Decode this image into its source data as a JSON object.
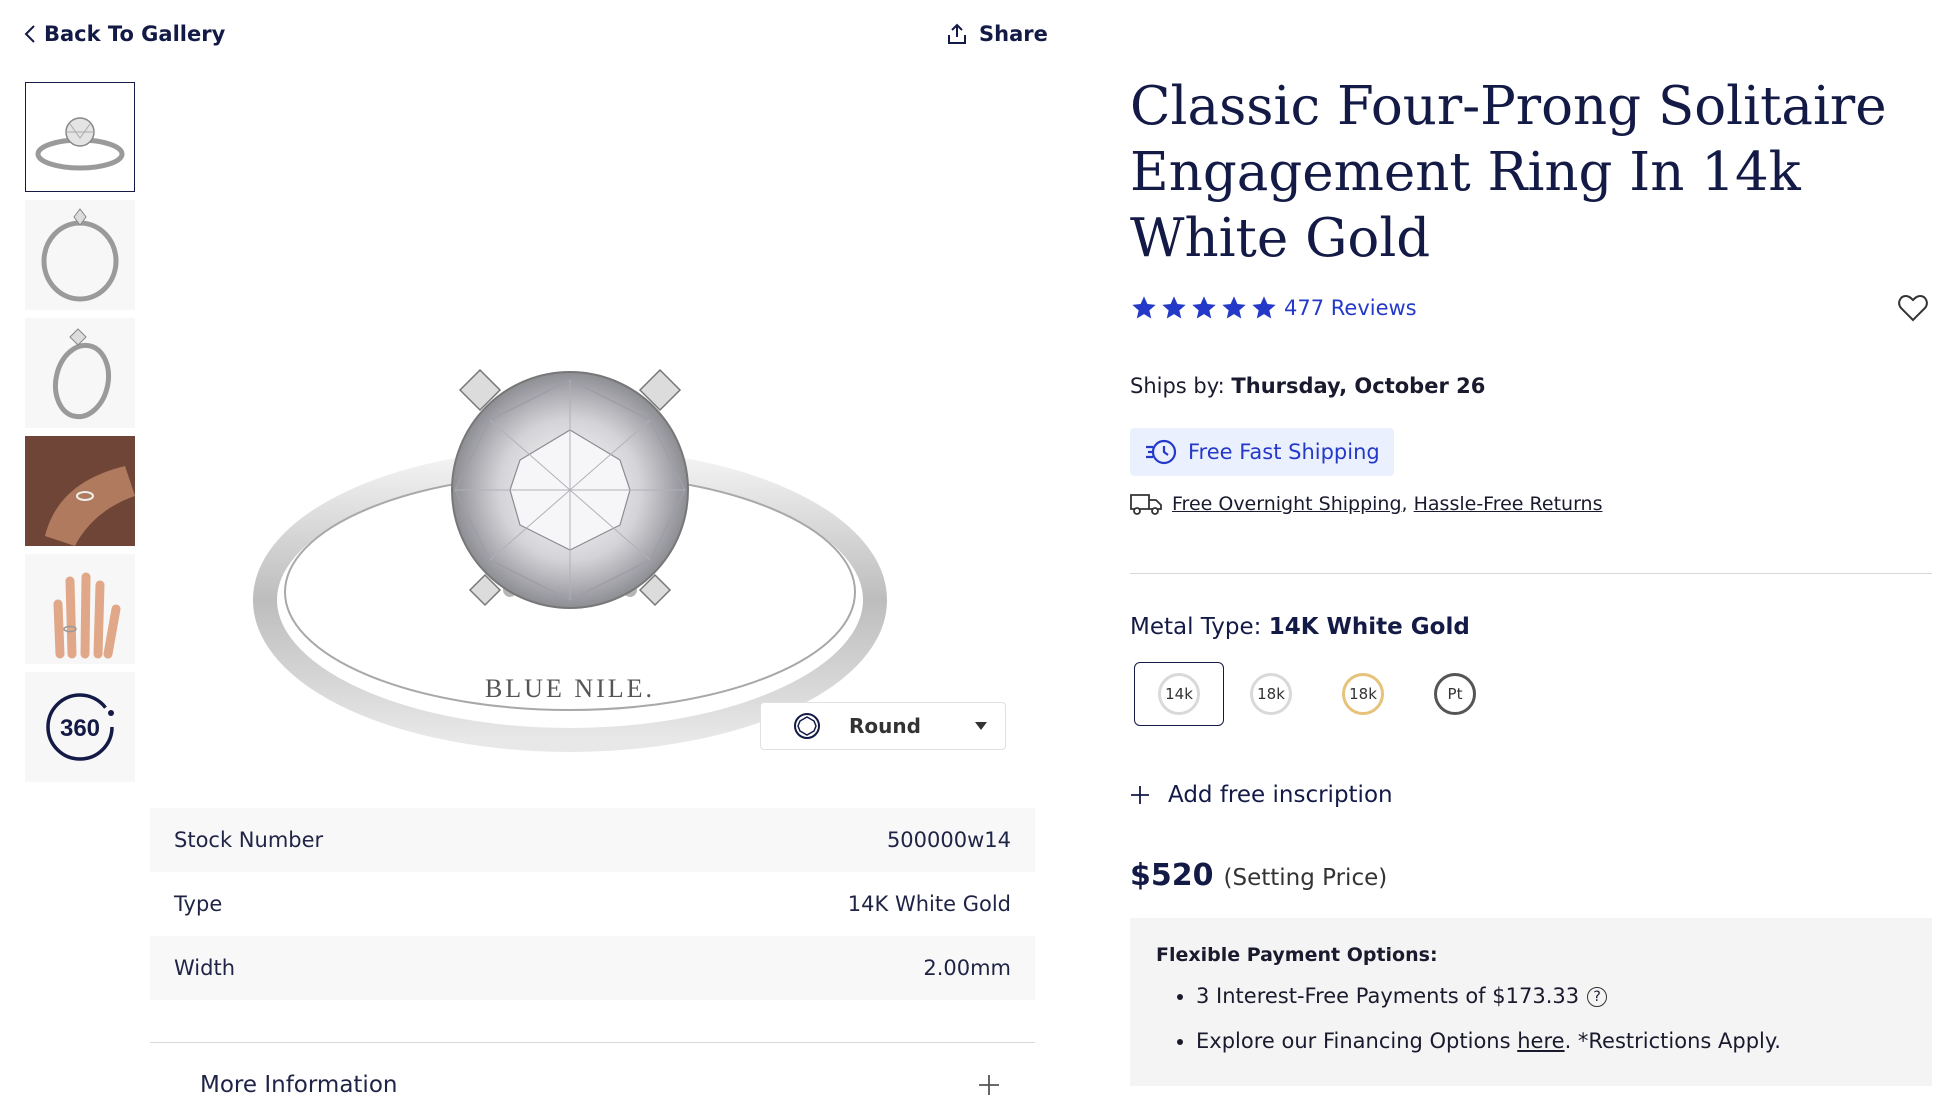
{
  "nav": {
    "back_label": "Back To Gallery",
    "share_label": "Share"
  },
  "gallery": {
    "thumbnails": [
      "front-view",
      "side-view",
      "angle-view",
      "hand-view",
      "hand-flat-view",
      "360-view"
    ],
    "badge_360": "360",
    "engraving": "BLUE NILE.",
    "shape_selector": "Round"
  },
  "specs": [
    {
      "label": "Stock Number",
      "value": "500000w14"
    },
    {
      "label": "Type",
      "value": "14K White Gold"
    },
    {
      "label": "Width",
      "value": "2.00mm"
    }
  ],
  "more_info_label": "More Information",
  "product": {
    "title": "Classic Four-Prong Solitaire Engagement Ring In 14k White Gold",
    "rating_stars": 5,
    "reviews": "477 Reviews",
    "ships_by_label": "Ships by:",
    "ships_by_date": "Thursday, October 26",
    "fast_shipping": "Free Fast Shipping",
    "overnight_shipping": "Free Overnight Shipping",
    "comma": ",",
    "returns": "Hassle-Free Returns",
    "metal_type_label": "Metal Type:",
    "metal_type_value": "14K White Gold",
    "metals": [
      {
        "label": "14k",
        "color": "#d9d9d9"
      },
      {
        "label": "18k",
        "color": "#d9d9d9"
      },
      {
        "label": "18k",
        "color": "#e6c27a"
      },
      {
        "label": "Pt",
        "color": "#555555"
      }
    ],
    "inscription": "Add free inscription",
    "price": "$520",
    "price_note": "(Setting Price)",
    "payment_heading": "Flexible Payment Options:",
    "payment_item_1": "3 Interest-Free Payments of $173.33",
    "payment_item_2_pre": "Explore our Financing Options",
    "payment_item_2_link": "here",
    "payment_item_2_post": ". *Restrictions Apply."
  },
  "colors": {
    "navy": "#141a46",
    "accent_blue": "#2439c8",
    "badge_bg": "#eaf0fd"
  }
}
